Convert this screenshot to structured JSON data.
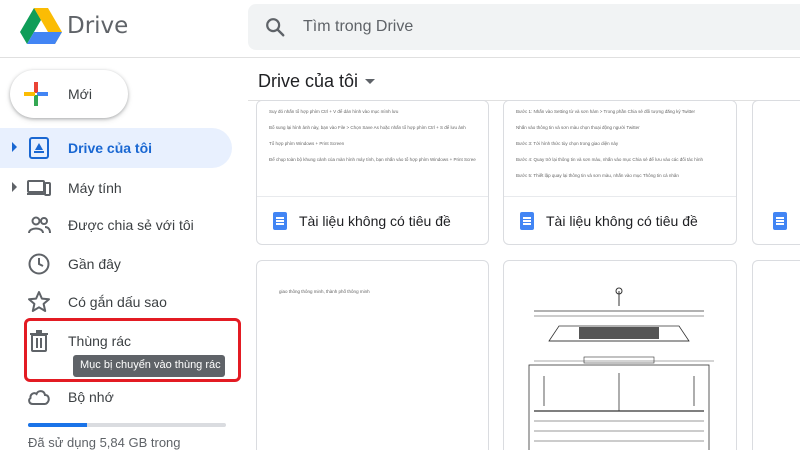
{
  "header": {
    "brand": "Drive",
    "search_placeholder": "Tìm trong Drive"
  },
  "sidebar": {
    "new_label": "Mới",
    "items": [
      {
        "label": "Drive của tôi"
      },
      {
        "label": "Máy tính"
      },
      {
        "label": "Được chia sẻ với tôi"
      },
      {
        "label": "Gần đây"
      },
      {
        "label": "Có gắn dấu sao"
      },
      {
        "label": "Thùng rác"
      },
      {
        "label": "Bộ nhớ"
      }
    ],
    "trash_tooltip": "Mục bị chuyển vào thùng rác",
    "storage_text": "Đã sử dụng 5,84 GB trong",
    "storage_fraction": 0.3
  },
  "main": {
    "title": "Drive của tôi",
    "files": [
      {
        "name": "Tài liệu không có tiêu đề"
      },
      {
        "name": "Tài liệu không có tiêu đề"
      }
    ],
    "preview_lines_1": [
      "Suy đó nhấn tổ hợp phím Ctrl + V để dán hình vào mục mình lưu",
      "Bổ sung lại hình ảnh này, bạn vào File > Chọn Save As hoặc nhấn tổ hợp phím Ctrl + S để lưu ảnh",
      "Tổ hợp phím Windows + Print Screen",
      "Để chụp toàn bộ khung cảnh của màn hình máy tính, bạn nhấn vào tổ hợp phím Windows + Print Screen ở trên bàn phím."
    ],
    "preview_lines_2": [
      "Bước 1: Nhấn vào Setting từ và sơn hàm > Trong phần Chia sẻ đối tượng đăng ký Twitter",
      "Nhấn vào thông tin và sơn màu chọn thoại động người Twitter",
      "Bước 3: Tới hình thức tùy chọn trong giao diện này",
      "Bước 4: Quay trở lại thông tin và sơn màu, nhấn vào mục Chia sẻ để lưu vào các đối tác hình",
      "Bước 5: Thiết lập quay lại thông tin và sơn màu, nhấn vào mục Thông tin cá nhân"
    ],
    "preview_line_3": "giao thông thông minh, thành phố thông minh"
  },
  "colors": {
    "accent": "#1a73e8",
    "active_bg": "#e8f0fe",
    "highlight": "#e31b23",
    "tooltip_bg": "#5f6368"
  }
}
